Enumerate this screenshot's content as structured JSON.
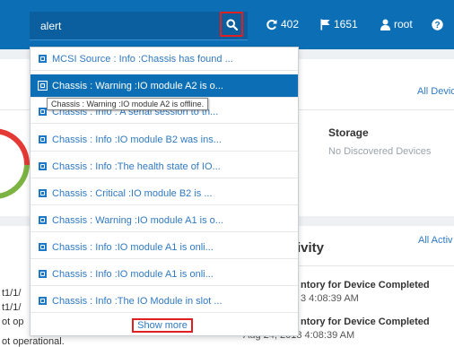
{
  "search": {
    "value": "alert"
  },
  "header": {
    "refresh_count": "402",
    "flag_count": "1651",
    "user": "root"
  },
  "dashboard": {
    "all_devices_link": "All Devic",
    "storage_title": "Storage",
    "storage_empty": "No Discovered Devices",
    "activity_title": "ivity",
    "all_activity_link": "All Activ",
    "activity_items": [
      {
        "title": "ntory for Device Completed",
        "time": "3 4:08:39 AM"
      },
      {
        "title": "ntory for Device Completed",
        "time": "Aug 24, 2018 4:08:39 AM"
      }
    ],
    "left_fragments": [
      "t1/1/",
      "t1/1/",
      "ot op",
      "ot operational."
    ]
  },
  "dropdown": {
    "items": [
      "MCSI Source : Info :Chassis has found ...",
      "Chassis : Warning :IO module A2 is o...",
      "Chassis : Info : A serial session to th...",
      "Chassis : Info :IO module B2 was ins...",
      "Chassis : Info :The health state of IO...",
      "Chassis : Critical :IO module B2 is ...",
      "Chassis : Warning :IO module A1 is o...",
      "Chassis : Info :IO module A1 is onli...",
      "Chassis : Info :IO module A1 is onli...",
      "Chassis : Info :The IO Module in slot ..."
    ],
    "active_index": 1,
    "show_more": "Show more",
    "tooltip": "Chassis : Warning :IO module A2 is offline."
  },
  "colors": {
    "topbar": "#0c6fb5",
    "highlight_border": "#e02020",
    "donut_red": "#e53935",
    "donut_green": "#7cb342"
  },
  "icons": {
    "search": "search-icon",
    "refresh": "refresh-icon",
    "flag": "flag-icon",
    "user": "user-icon",
    "help": "help-icon",
    "alert_item": "chassis-alert-icon"
  }
}
